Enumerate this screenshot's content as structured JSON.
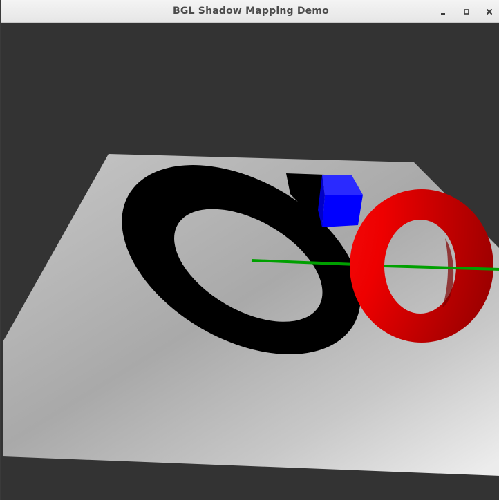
{
  "window": {
    "title": "BGL Shadow Mapping Demo",
    "controls": {
      "minimize_icon": "minimize-icon",
      "maximize_icon": "maximize-icon",
      "close_icon": "close-icon"
    }
  },
  "scene": {
    "background_color": "#333333",
    "objects": [
      {
        "name": "ground-plane",
        "color": "#d6d6d6"
      },
      {
        "name": "torus",
        "color": "#ff0000"
      },
      {
        "name": "cube",
        "color": "#0000ff"
      },
      {
        "name": "axis-line",
        "color": "#00aa00"
      }
    ],
    "shadow_color": "#000000"
  }
}
